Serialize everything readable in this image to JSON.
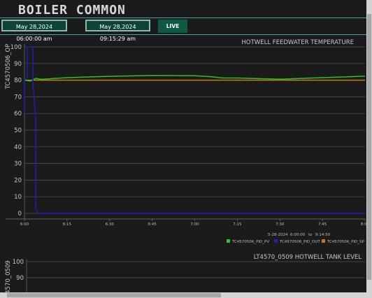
{
  "app": {
    "title": "BOILER COMMON"
  },
  "toolbar": {
    "start_time": "May 28,2024 06:00:00 am",
    "end_time": "May 28,2024 09:15:29 am",
    "live_label": "LIVE"
  },
  "chart_data": [
    {
      "type": "line",
      "title": "HOTWELL FEEDWATER TEMPERATURE",
      "ylabel": "TC4570506_OP",
      "ylim": [
        0,
        100
      ],
      "yticks": [
        0,
        10,
        20,
        30,
        40,
        50,
        60,
        70,
        80,
        90,
        100
      ],
      "x_tick_labels": [
        "6:00",
        "6:15",
        "6:30",
        "6:45",
        "7:00",
        "7:15",
        "7:30",
        "7:45",
        "8:00"
      ],
      "x_range_label": {
        "date": "5-28-2024",
        "start": "6:00:00",
        "to": "to",
        "end": "9:14:50"
      },
      "grid": true,
      "legend_position": "bottom-right",
      "series": [
        {
          "name": "TC4570506_PID_PV",
          "color": "#2fbf2f",
          "points": [
            [
              "6:00",
              80
            ],
            [
              "6:02",
              79.5
            ],
            [
              "6:04",
              81
            ],
            [
              "6:06",
              80.5
            ],
            [
              "6:15",
              81.5
            ],
            [
              "6:30",
              82.3
            ],
            [
              "6:45",
              82.8
            ],
            [
              "7:00",
              82.7
            ],
            [
              "7:06",
              82
            ],
            [
              "7:10",
              81.3
            ],
            [
              "7:15",
              81.3
            ],
            [
              "7:30",
              80.6
            ],
            [
              "7:45",
              81.5
            ],
            [
              "8:00",
              82.4
            ]
          ]
        },
        {
          "name": "TC4570506_PID_OUT",
          "color": "#1f1fb4",
          "points": [
            [
              "6:00",
              60
            ],
            [
              "6:00",
              80
            ],
            [
              "6:01",
              82
            ],
            [
              "6:01",
              100
            ],
            [
              "6:02",
              100
            ],
            [
              "6:03",
              99
            ],
            [
              "6:03",
              78
            ],
            [
              "6:04",
              56
            ],
            [
              "6:04",
              2
            ],
            [
              "6:05",
              0
            ],
            [
              "8:00",
              0
            ]
          ]
        },
        {
          "name": "TC4570506_PID_SP",
          "color": "#c57a18",
          "points": [
            [
              "6:00",
              80
            ],
            [
              "8:00",
              80
            ]
          ]
        }
      ]
    },
    {
      "type": "line",
      "title": "LT4570_0509 HOTWELL TANK LEVEL",
      "ylabel": "4570_0509",
      "ylim": [
        80,
        100
      ],
      "yticks": [
        90,
        100
      ],
      "grid": true,
      "series": []
    }
  ],
  "colors": {
    "accent": "#4aa0a8",
    "button_bg": "#0e4438",
    "live_bg": "#0f5a44",
    "background": "#1b1b1b"
  }
}
